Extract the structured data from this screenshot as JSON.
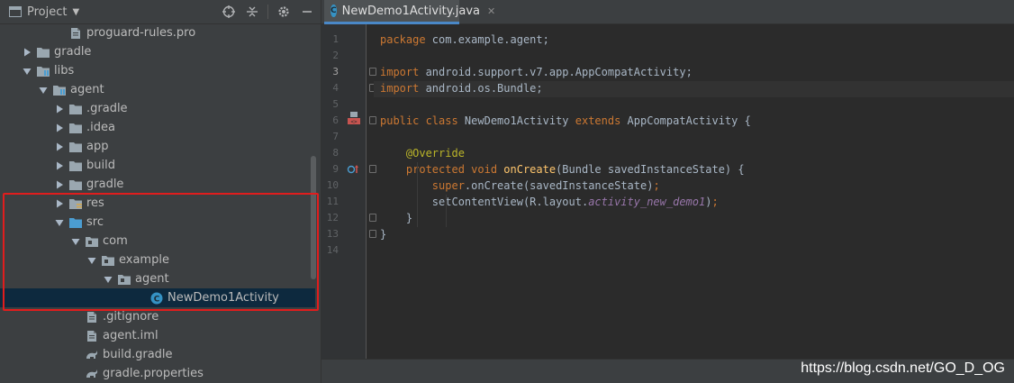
{
  "project_panel": {
    "title": "Project",
    "tools": [
      "target-icon",
      "collapse-icon",
      "gear-icon",
      "minimize-icon"
    ],
    "tree": [
      {
        "label": "proguard-rules.pro",
        "icon": "file-icon",
        "arrow": "none",
        "indent": 3
      },
      {
        "label": "gradle",
        "icon": "folder-icon",
        "arrow": "right",
        "indent": 1
      },
      {
        "label": "libs",
        "icon": "module-folder-icon",
        "arrow": "down",
        "indent": 1
      },
      {
        "label": "agent",
        "icon": "module-folder-icon",
        "arrow": "down",
        "indent": 2
      },
      {
        "label": ".gradle",
        "icon": "folder-icon",
        "arrow": "right",
        "indent": 3
      },
      {
        "label": ".idea",
        "icon": "folder-icon",
        "arrow": "right",
        "indent": 3
      },
      {
        "label": "app",
        "icon": "folder-icon",
        "arrow": "right",
        "indent": 3
      },
      {
        "label": "build",
        "icon": "folder-icon",
        "arrow": "right",
        "indent": 3
      },
      {
        "label": "gradle",
        "icon": "folder-icon",
        "arrow": "right",
        "indent": 3
      },
      {
        "label": "res",
        "icon": "resource-folder-icon",
        "arrow": "right",
        "indent": 3
      },
      {
        "label": "src",
        "icon": "source-folder-icon",
        "arrow": "down",
        "indent": 3
      },
      {
        "label": "com",
        "icon": "package-icon",
        "arrow": "down",
        "indent": 4
      },
      {
        "label": "example",
        "icon": "package-icon",
        "arrow": "down",
        "indent": 5
      },
      {
        "label": "agent",
        "icon": "package-icon",
        "arrow": "down",
        "indent": 6
      },
      {
        "label": "NewDemo1Activity",
        "icon": "java-class-icon",
        "arrow": "none",
        "indent": 8,
        "selected": true
      },
      {
        "label": ".gitignore",
        "icon": "file-icon",
        "arrow": "none",
        "indent": 4
      },
      {
        "label": "agent.iml",
        "icon": "file-icon",
        "arrow": "none",
        "indent": 4
      },
      {
        "label": "build.gradle",
        "icon": "gradle-icon",
        "arrow": "none",
        "indent": 4
      },
      {
        "label": "gradle.properties",
        "icon": "gradle-icon",
        "arrow": "none",
        "indent": 4
      }
    ]
  },
  "editor": {
    "tab": {
      "label": "NewDemo1Activity.java",
      "icon_letter": "C"
    },
    "lines": [
      {
        "n": "1",
        "tokens": [
          [
            "kw",
            "package "
          ],
          [
            "pl",
            "com.example.agent;"
          ]
        ]
      },
      {
        "n": "2",
        "tokens": []
      },
      {
        "n": "3",
        "tokens": [
          [
            "kw",
            "import "
          ],
          [
            "pl",
            "android.support.v7.app.AppCompatActivity;"
          ]
        ],
        "current": true
      },
      {
        "n": "4",
        "tokens": [
          [
            "kw",
            "import "
          ],
          [
            "pl",
            "android.os.Bundle;"
          ]
        ]
      },
      {
        "n": "5",
        "tokens": []
      },
      {
        "n": "6",
        "tokens": [
          [
            "kw",
            "public class "
          ],
          [
            "pl",
            "NewDemo1Activity "
          ],
          [
            "kw",
            "extends "
          ],
          [
            "pl",
            "AppCompatActivity {"
          ]
        ]
      },
      {
        "n": "7",
        "tokens": []
      },
      {
        "n": "8",
        "tokens": [
          [
            "pl",
            "    "
          ],
          [
            "an",
            "@Override"
          ]
        ]
      },
      {
        "n": "9",
        "tokens": [
          [
            "pl",
            "    "
          ],
          [
            "kw",
            "protected void "
          ],
          [
            "fn",
            "onCreate"
          ],
          [
            "pl",
            "(Bundle savedInstanceState) {"
          ]
        ]
      },
      {
        "n": "10",
        "tokens": [
          [
            "pl",
            "        "
          ],
          [
            "kw",
            "super"
          ],
          [
            "pl",
            ".onCreate(savedInstanceState)"
          ],
          [
            "kw",
            ";"
          ]
        ]
      },
      {
        "n": "11",
        "tokens": [
          [
            "pl",
            "        setContentView(R.layout."
          ],
          [
            "it",
            "activity_new_demo1"
          ],
          [
            "pl",
            ")"
          ],
          [
            "kw",
            ";"
          ]
        ]
      },
      {
        "n": "12",
        "tokens": [
          [
            "pl",
            "    }"
          ]
        ]
      },
      {
        "n": "13",
        "tokens": [
          [
            "pl",
            "}"
          ]
        ]
      },
      {
        "n": "14",
        "tokens": []
      }
    ]
  },
  "watermark": "https://blog.csdn.net/GO_D_OG",
  "colors": {
    "keyword": "#cc7832",
    "plain": "#a9b7c6",
    "annotation": "#bbb529",
    "method": "#ffc66d",
    "field": "#9876aa",
    "highlight_box": "#e01d1d",
    "selected_row": "#0d293e"
  }
}
